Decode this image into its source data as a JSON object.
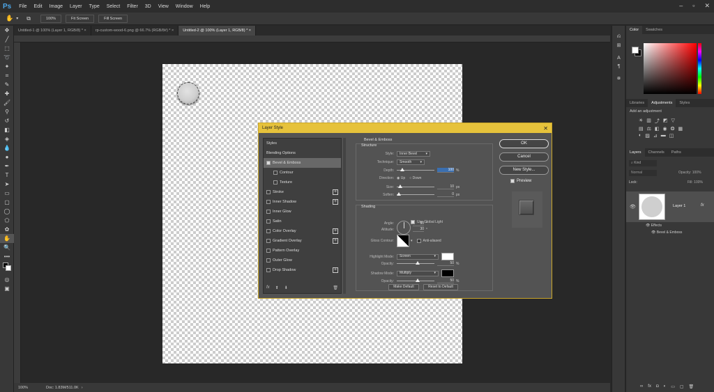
{
  "app": {
    "logo": "Ps",
    "menu": [
      "File",
      "Edit",
      "Image",
      "Layer",
      "Type",
      "Select",
      "Filter",
      "3D",
      "View",
      "Window",
      "Help"
    ]
  },
  "options": {
    "zoom_btn": "100%",
    "fit_btn": "Fit Screen",
    "fill_btn": "Fill Screen"
  },
  "tabs": [
    {
      "label": "Untitled-1 @ 100% (Layer 1, RGB/8) *",
      "close": "×"
    },
    {
      "label": "rp-custom-wood-6.png @ 66.7% (RGB/8#) *",
      "close": "×"
    },
    {
      "label": "Untitled-2 @ 100% (Layer 1, RGB/8) *",
      "close": "×"
    }
  ],
  "status": {
    "zoom": "100%",
    "doc": "Doc: 1.83M/511.0K"
  },
  "panels": {
    "color_tabs": [
      "Color",
      "Swatches"
    ],
    "adj_tabs": [
      "Libraries",
      "Adjustments",
      "Styles"
    ],
    "adj_title": "Add an adjustment",
    "layer_tabs": [
      "Layers",
      "Channels",
      "Paths"
    ],
    "kind": "Kind",
    "blend": "Normal",
    "opacity_label": "Opacity:",
    "opacity": "100%",
    "lock_label": "Lock:",
    "fill_label": "Fill:",
    "fill": "100%",
    "layer_name": "Layer 1",
    "effects": "Effects",
    "effect_item": "Bevel & Emboss",
    "fx": "fx"
  },
  "dialog": {
    "title": "Layer Style",
    "styles": [
      {
        "label": "Styles",
        "cb": false,
        "plus": false,
        "sub": false,
        "sel": false,
        "checked": false
      },
      {
        "label": "Blending Options",
        "cb": false,
        "plus": false,
        "sub": false,
        "sel": false,
        "checked": false
      },
      {
        "label": "Bevel & Emboss",
        "cb": true,
        "plus": false,
        "sub": false,
        "sel": true,
        "checked": true
      },
      {
        "label": "Contour",
        "cb": true,
        "plus": false,
        "sub": true,
        "sel": false,
        "checked": false
      },
      {
        "label": "Texture",
        "cb": true,
        "plus": false,
        "sub": true,
        "sel": false,
        "checked": false
      },
      {
        "label": "Stroke",
        "cb": true,
        "plus": true,
        "sub": false,
        "sel": false,
        "checked": false
      },
      {
        "label": "Inner Shadow",
        "cb": true,
        "plus": true,
        "sub": false,
        "sel": false,
        "checked": false
      },
      {
        "label": "Inner Glow",
        "cb": true,
        "plus": false,
        "sub": false,
        "sel": false,
        "checked": false
      },
      {
        "label": "Satin",
        "cb": true,
        "plus": false,
        "sub": false,
        "sel": false,
        "checked": false
      },
      {
        "label": "Color Overlay",
        "cb": true,
        "plus": true,
        "sub": false,
        "sel": false,
        "checked": false
      },
      {
        "label": "Gradient Overlay",
        "cb": true,
        "plus": true,
        "sub": false,
        "sel": false,
        "checked": false
      },
      {
        "label": "Pattern Overlay",
        "cb": true,
        "plus": false,
        "sub": false,
        "sel": false,
        "checked": false
      },
      {
        "label": "Outer Glow",
        "cb": true,
        "plus": false,
        "sub": false,
        "sel": false,
        "checked": false
      },
      {
        "label": "Drop Shadow",
        "cb": true,
        "plus": true,
        "sub": false,
        "sel": false,
        "checked": false
      }
    ],
    "section": "Bevel & Emboss",
    "structure": "Structure",
    "style_label": "Style:",
    "style_value": "Inner Bevel",
    "technique_label": "Technique:",
    "technique_value": "Smooth",
    "depth_label": "Depth:",
    "depth_value": "100",
    "depth_unit": "%",
    "depth_level": 0.1,
    "direction_label": "Direction:",
    "dir_up": "Up",
    "dir_down": "Down",
    "size_label": "Size:",
    "size_value": "10",
    "size_unit": "px",
    "size_level": 0.04,
    "soften_label": "Soften:",
    "soften_value": "0",
    "soften_unit": "px",
    "soften_level": 0.0,
    "shading": "Shading",
    "angle_label": "Angle:",
    "angle_value": "90",
    "angle_unit": "°",
    "global_light": "Use Global Light",
    "altitude_label": "Altitude:",
    "altitude_value": "30",
    "altitude_unit": "°",
    "gloss_label": "Gloss Contour:",
    "anti_aliased": "Anti-aliased",
    "highlight_label": "Highlight Mode:",
    "highlight_value": "Screen",
    "highlight_color": "#ffffff",
    "hopacity_label": "Opacity:",
    "hopacity_value": "50",
    "hopacity_unit": "%",
    "hopacity_level": 0.5,
    "shadow_label": "Shadow Mode:",
    "shadow_value": "Multiply",
    "shadow_color": "#000000",
    "sopacity_label": "Opacity:",
    "sopacity_value": "50",
    "sopacity_unit": "%",
    "sopacity_level": 0.5,
    "make_default": "Make Default",
    "reset_default": "Reset to Default",
    "ok": "OK",
    "cancel": "Cancel",
    "new_style": "New Style...",
    "preview": "Preview",
    "fx": "fx"
  }
}
